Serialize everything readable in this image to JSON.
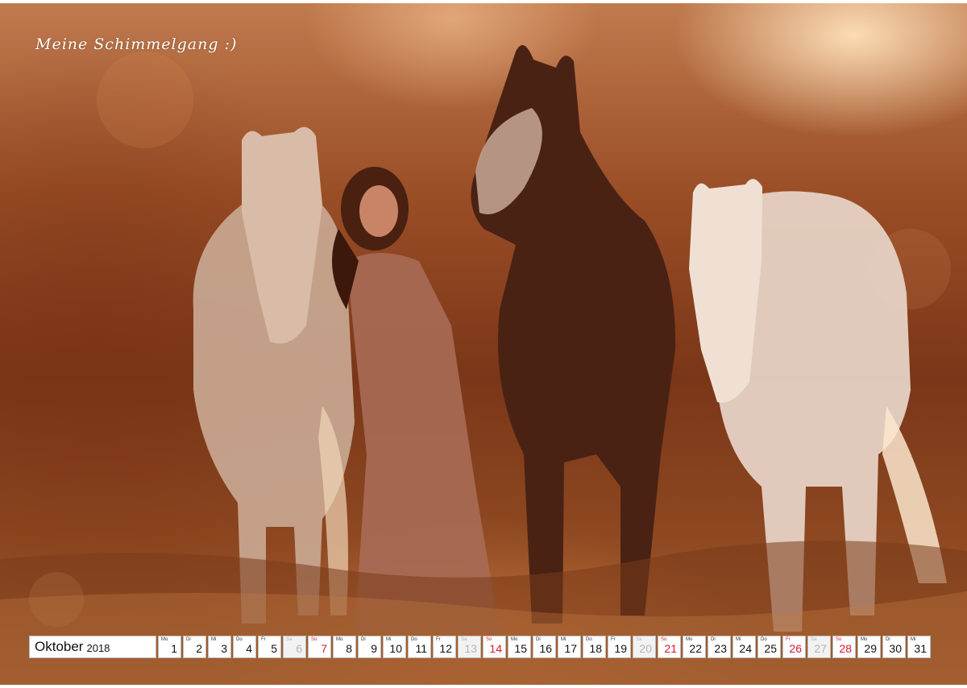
{
  "caption": "Meine Schimmelgang :)",
  "calendar": {
    "month": "Oktober",
    "year": "2018",
    "days": [
      {
        "wd": "Mo",
        "num": "1",
        "type": "weekday"
      },
      {
        "wd": "Di",
        "num": "2",
        "type": "weekday"
      },
      {
        "wd": "Mi",
        "num": "3",
        "type": "weekday"
      },
      {
        "wd": "Do",
        "num": "4",
        "type": "weekday"
      },
      {
        "wd": "Fr",
        "num": "5",
        "type": "weekday"
      },
      {
        "wd": "Sa",
        "num": "6",
        "type": "saturday"
      },
      {
        "wd": "So",
        "num": "7",
        "type": "sunday"
      },
      {
        "wd": "Mo",
        "num": "8",
        "type": "weekday"
      },
      {
        "wd": "Di",
        "num": "9",
        "type": "weekday"
      },
      {
        "wd": "Mi",
        "num": "10",
        "type": "weekday"
      },
      {
        "wd": "Do",
        "num": "11",
        "type": "weekday"
      },
      {
        "wd": "Fr",
        "num": "12",
        "type": "weekday"
      },
      {
        "wd": "Sa",
        "num": "13",
        "type": "saturday"
      },
      {
        "wd": "So",
        "num": "14",
        "type": "sunday"
      },
      {
        "wd": "Mo",
        "num": "15",
        "type": "weekday"
      },
      {
        "wd": "Di",
        "num": "16",
        "type": "weekday"
      },
      {
        "wd": "Mi",
        "num": "17",
        "type": "weekday"
      },
      {
        "wd": "Do",
        "num": "18",
        "type": "weekday"
      },
      {
        "wd": "Fr",
        "num": "19",
        "type": "weekday"
      },
      {
        "wd": "Sa",
        "num": "20",
        "type": "saturday"
      },
      {
        "wd": "So",
        "num": "21",
        "type": "sunday"
      },
      {
        "wd": "Mo",
        "num": "22",
        "type": "weekday"
      },
      {
        "wd": "Di",
        "num": "23",
        "type": "weekday"
      },
      {
        "wd": "Mi",
        "num": "24",
        "type": "weekday"
      },
      {
        "wd": "Do",
        "num": "25",
        "type": "weekday"
      },
      {
        "wd": "Fr",
        "num": "26",
        "type": "sunday"
      },
      {
        "wd": "Sa",
        "num": "27",
        "type": "saturday"
      },
      {
        "wd": "So",
        "num": "28",
        "type": "sunday"
      },
      {
        "wd": "Mo",
        "num": "29",
        "type": "weekday"
      },
      {
        "wd": "Di",
        "num": "30",
        "type": "weekday"
      },
      {
        "wd": "Mi",
        "num": "31",
        "type": "weekday"
      }
    ]
  },
  "colors": {
    "holiday_red": "#d8182a",
    "saturday_grey": "#b4b4b4",
    "sunset_orange": "#b06a3a"
  }
}
